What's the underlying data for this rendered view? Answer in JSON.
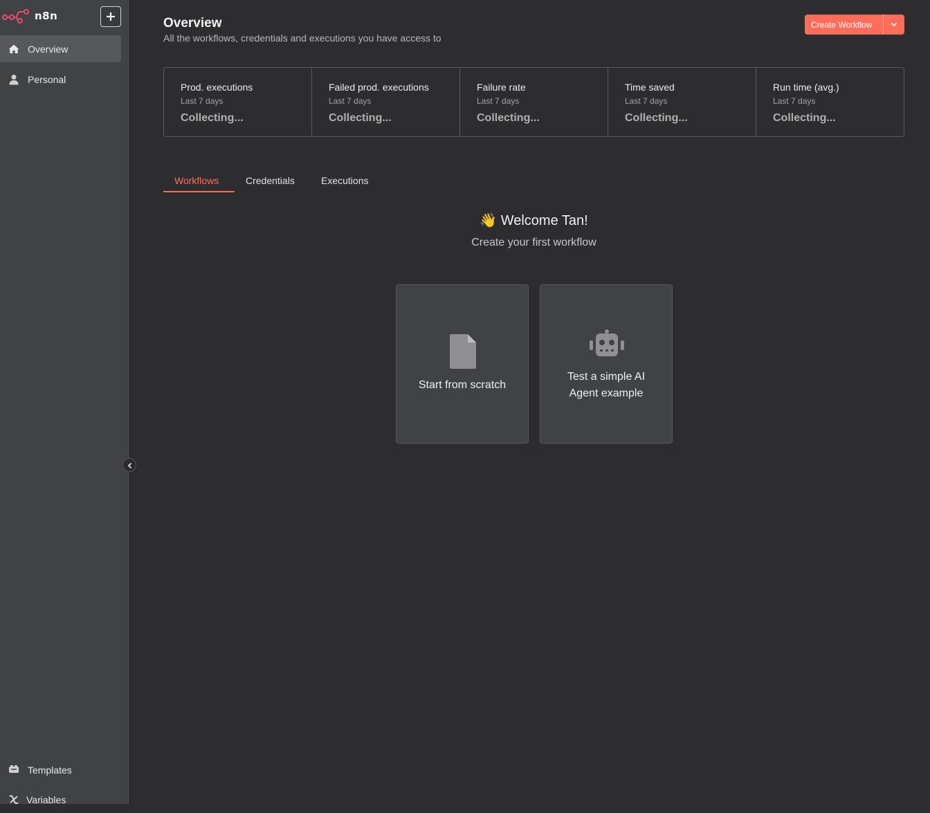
{
  "app": {
    "logo_text": "n8n",
    "accent_color": "#ff6d5a"
  },
  "sidebar": {
    "add_icon": "plus-icon",
    "items": [
      {
        "label": "Overview",
        "icon": "home-icon",
        "active": true
      },
      {
        "label": "Personal",
        "icon": "user-icon",
        "active": false
      }
    ],
    "bottom_items": [
      {
        "label": "Templates",
        "icon": "box-icon"
      },
      {
        "label": "Variables",
        "icon": "variable-icon"
      }
    ]
  },
  "header": {
    "title": "Overview",
    "subtitle": "All the workflows, credentials and executions you have access to",
    "create_button_label": "Create Workflow"
  },
  "stats": [
    {
      "label": "Prod. executions",
      "period": "Last 7 days",
      "value": "Collecting..."
    },
    {
      "label": "Failed prod. executions",
      "period": "Last 7 days",
      "value": "Collecting..."
    },
    {
      "label": "Failure rate",
      "period": "Last 7 days",
      "value": "Collecting..."
    },
    {
      "label": "Time saved",
      "period": "Last 7 days",
      "value": "Collecting..."
    },
    {
      "label": "Run time (avg.)",
      "period": "Last 7 days",
      "value": "Collecting..."
    }
  ],
  "tabs": [
    {
      "label": "Workflows",
      "active": true
    },
    {
      "label": "Credentials",
      "active": false
    },
    {
      "label": "Executions",
      "active": false
    }
  ],
  "welcome": {
    "title": "👋 Welcome Tan!",
    "subtitle": "Create your first workflow"
  },
  "cards": [
    {
      "label": "Start from scratch",
      "icon": "file-icon"
    },
    {
      "label": "Test a simple AI Agent example",
      "icon": "robot-icon"
    }
  ]
}
